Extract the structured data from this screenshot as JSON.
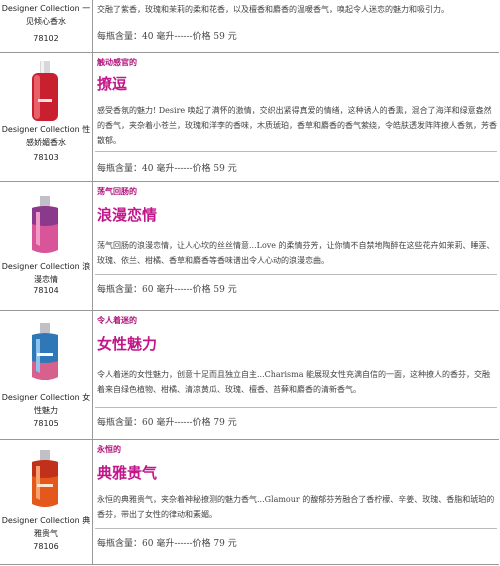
{
  "products": [
    {
      "name": "Designer Collection 一见倾心香水",
      "code": "78102",
      "tag": "",
      "title": "",
      "desc": "交融了紫香，玫瑰和茉莉的柔和花香，以及檀香和麝香的温暖香气，唤起令人迷恋的魅力和吸引力。",
      "price": "每瓶含量：40 毫升------价格 59 元"
    },
    {
      "name": "Designer Collection 性感娇媚香水",
      "code": "78103",
      "tag": "触动感官的",
      "title": "撩逗",
      "desc": "感受香氛的魅力! Desire 唤起了满怀的激情，交织出紧得真爱的情绪，这种诱人的香熏，混合了海洋和绿意盎然的香气，夹杂着小苍兰，玫瑰和洋李的香味，木质琥珀，香草和麝香的香气萦绕，令皓肤透发阵阵撩人香氛，芳香散郁。",
      "price": "每瓶含量：40 毫升------价格 59 元"
    },
    {
      "name": "Designer Collection 浪漫恋情",
      "code": "78104",
      "tag": "荡气回肠的",
      "title": "浪漫恋情",
      "desc": "荡气回肠的浪漫恋情，让人心坎的丝丝情意...Love 的柔情芬芳，让你情不自禁地陶醉在这些花卉如茉莉、睡莲、玫瑰、依兰、柑橘、香草和麝香等香味谱出令人心动的浪漫恋曲。",
      "price": "每瓶含量：60 毫升------价格 59 元"
    },
    {
      "name": "Designer Collection 女性魅力",
      "code": "78105",
      "tag": "令人着迷的",
      "title": "女性魅力",
      "desc": "令人着迷的女性魅力，创意十足而且独立自主...Charisma 能展现女性充满自信的一面，这种撩人的香芬，交融着来自绿色植物、柑橘、清凉黄瓜、玫瑰、檀香、苔藓和麝香的清新香气。",
      "price": "每瓶含量：60 毫升------价格 79 元"
    },
    {
      "name": "Designer Collection 典雅贵气",
      "code": "78106",
      "tag": "永恒的",
      "title": "典雅贵气",
      "desc": "永恒的典雅贵气，夹杂着神秘撩测的魅力香气...Glamour 的馥郁芬芳融合了香柠檬、辛姜、玫瑰、香脂和琥珀的香芬，带出了女性的律动和素媚。",
      "price": "每瓶含量：60 毫升------价格 79 元"
    }
  ]
}
